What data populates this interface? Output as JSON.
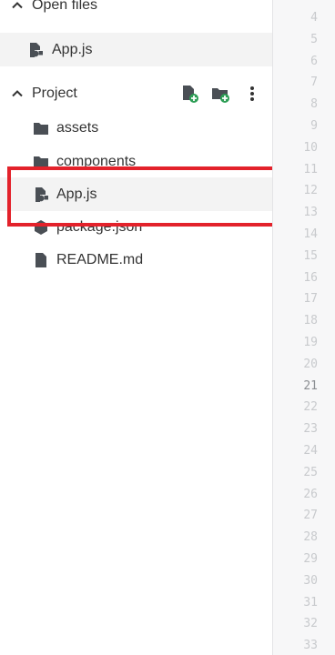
{
  "open_files": {
    "header": "Open files",
    "items": [
      {
        "name": "App.js",
        "icon": "js-file-icon"
      }
    ]
  },
  "project": {
    "header": "Project",
    "actions": [
      {
        "icon": "new-file-icon",
        "accent": "#2e9e56"
      },
      {
        "icon": "new-folder-icon",
        "accent": "#2e9e56"
      },
      {
        "icon": "more-vertical-icon"
      }
    ],
    "items": [
      {
        "name": "assets",
        "icon": "folder-icon"
      },
      {
        "name": "components",
        "icon": "folder-icon"
      },
      {
        "name": "App.js",
        "icon": "js-file-icon",
        "selected": true
      },
      {
        "name": "package.json",
        "icon": "package-icon"
      },
      {
        "name": "README.md",
        "icon": "file-icon"
      }
    ]
  },
  "gutter": {
    "line_numbers": [
      "4",
      "5",
      "6",
      "7",
      "8",
      "9",
      "10",
      "11",
      "12",
      "13",
      "14",
      "15",
      "16",
      "17",
      "18",
      "19",
      "20",
      "21",
      "22",
      "23",
      "24",
      "25",
      "26",
      "27",
      "28",
      "29",
      "30",
      "31",
      "32",
      "33"
    ],
    "active_line": "21"
  },
  "colors": {
    "highlight_border": "#e3222b",
    "icon_gray": "#4a4f55",
    "add_badge_green": "#2e9e56"
  }
}
